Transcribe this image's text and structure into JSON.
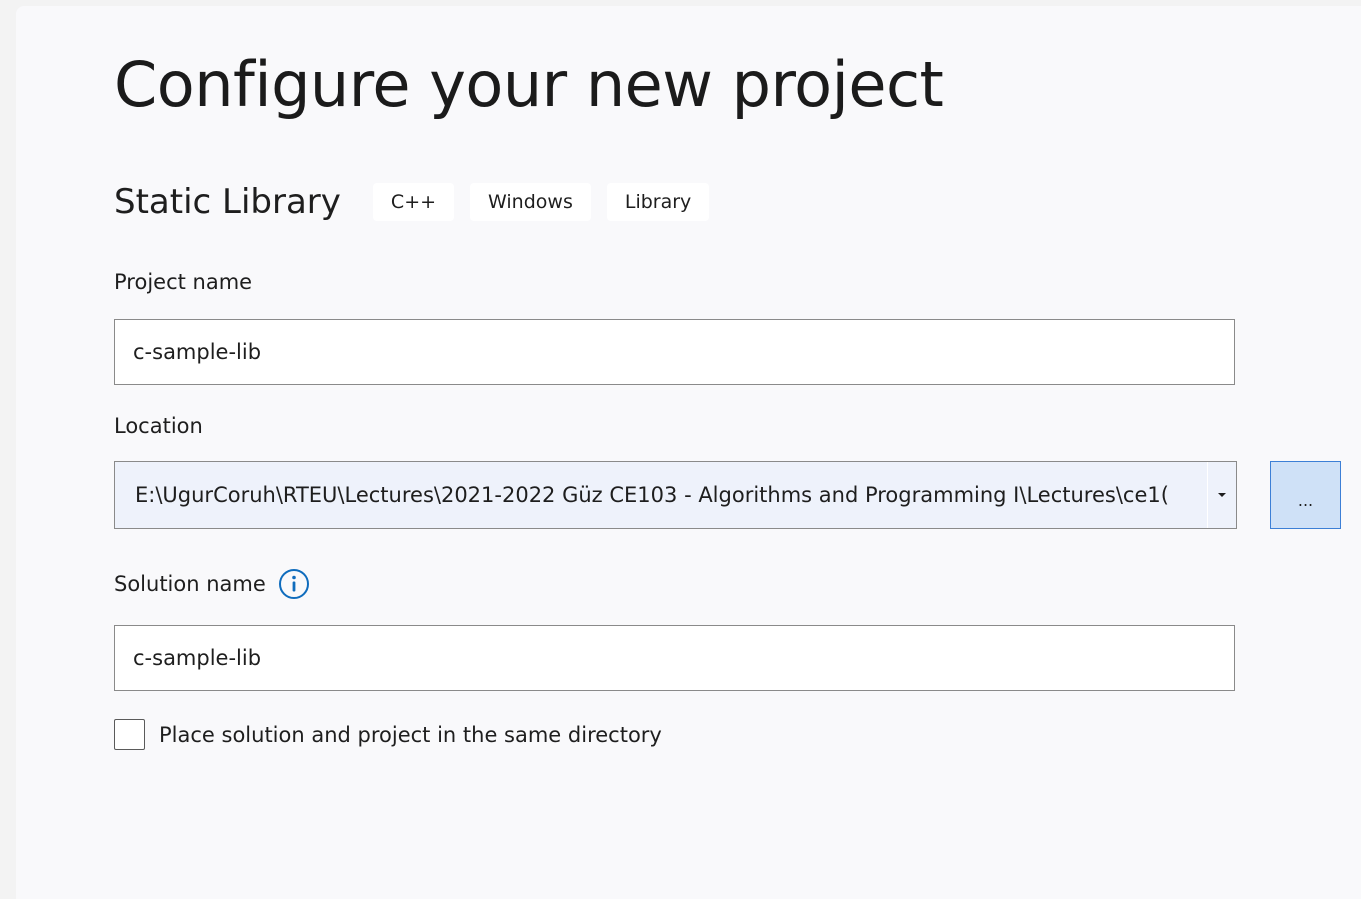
{
  "page": {
    "title": "Configure your new project"
  },
  "template": {
    "name": "Static Library",
    "tags": [
      "C++",
      "Windows",
      "Library"
    ]
  },
  "project_name": {
    "label": "Project name",
    "value": "c-sample-lib"
  },
  "location": {
    "label": "Location",
    "value": "E:\\UgurCoruh\\RTEU\\Lectures\\2021-2022 Güz CE103 - Algorithms and Programming I\\Lectures\\ce1(",
    "browse_label": "..."
  },
  "solution_name": {
    "label": "Solution name",
    "value": "c-sample-lib"
  },
  "same_directory": {
    "label": "Place solution and project in the same directory",
    "checked": false
  },
  "colors": {
    "accent": "#0f6cbd",
    "browse_bg": "#cfe1f7",
    "browse_border": "#3c7fd6"
  },
  "icons": {
    "info": "info-icon",
    "dropdown": "chevron-down-icon"
  }
}
